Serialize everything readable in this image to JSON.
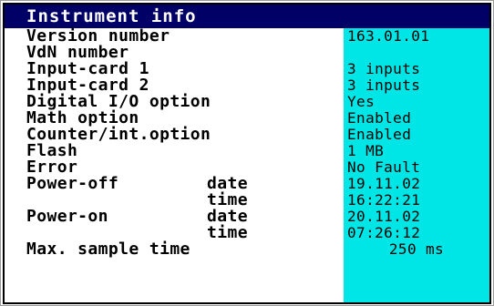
{
  "window": {
    "title": "Instrument info"
  },
  "rows": [
    {
      "label": "Version number",
      "sub": "",
      "value": "163.01.01"
    },
    {
      "label": "VdN number",
      "sub": "",
      "value": ""
    },
    {
      "label": "Input-card 1",
      "sub": "",
      "value": "3 inputs"
    },
    {
      "label": "Input-card 2",
      "sub": "",
      "value": "3 inputs"
    },
    {
      "label": "Digital I/O option",
      "sub": "",
      "value": "Yes"
    },
    {
      "label": "Math option",
      "sub": "",
      "value": "Enabled"
    },
    {
      "label": "Counter/int.option",
      "sub": "",
      "value": "Enabled"
    },
    {
      "label": "Flash",
      "sub": "",
      "value": "1 MB"
    },
    {
      "label": "Error",
      "sub": "",
      "value": "No Fault"
    },
    {
      "label": "Power-off",
      "sub": "date",
      "value": "19.11.02"
    },
    {
      "label": "",
      "sub": "time",
      "value": "16:22:21"
    },
    {
      "label": "Power-on",
      "sub": "date",
      "value": "20.11.02"
    },
    {
      "label": "",
      "sub": "time",
      "value": "07:26:12"
    },
    {
      "label": "Max. sample time",
      "sub": "",
      "value": "250 ms"
    }
  ],
  "colors": {
    "title_bg": "#000066",
    "title_fg": "#ffffff",
    "value_bg": "#00e6e6"
  }
}
